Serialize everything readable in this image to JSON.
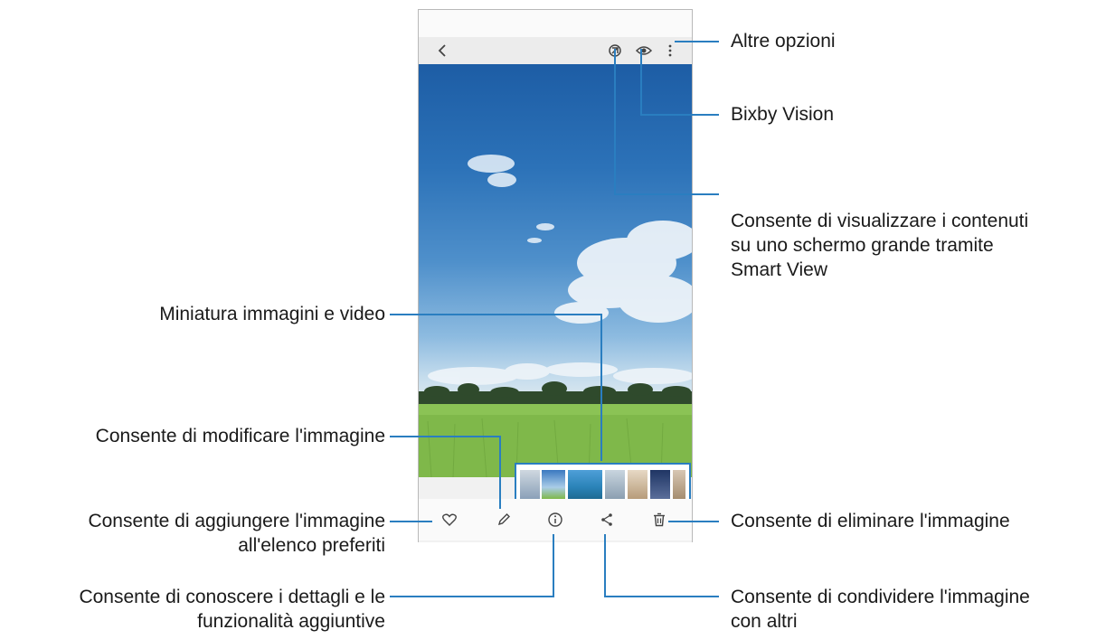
{
  "callouts": {
    "more_options": "Altre opzioni",
    "bixby_vision": "Bixby Vision",
    "smart_view": [
      "Consente di visualizzare i contenuti",
      "su uno schermo grande tramite",
      "Smart View"
    ],
    "thumbnails": "Miniatura immagini e video",
    "edit": "Consente di modificare l'immagine",
    "favorite": [
      "Consente di aggiungere l'immagine",
      "all'elenco preferiti"
    ],
    "delete": "Consente di eliminare l'immagine",
    "details": [
      "Consente di conoscere i dettagli e le",
      "funzionalità aggiuntive"
    ],
    "share": [
      "Consente di condividere l'immagine",
      "con altri"
    ]
  },
  "icons": {
    "back": "chevron-left-icon",
    "smart_view": "smart-view-icon",
    "bixby_vision": "eye-icon",
    "more": "more-vertical-icon",
    "favorite": "heart-icon",
    "edit": "pencil-icon",
    "details": "info-icon",
    "share": "share-icon",
    "delete": "trash-icon"
  },
  "colors": {
    "callout_line": "#2a7ec0",
    "sky": "#2c72b8",
    "grass": "#7fb84a"
  }
}
